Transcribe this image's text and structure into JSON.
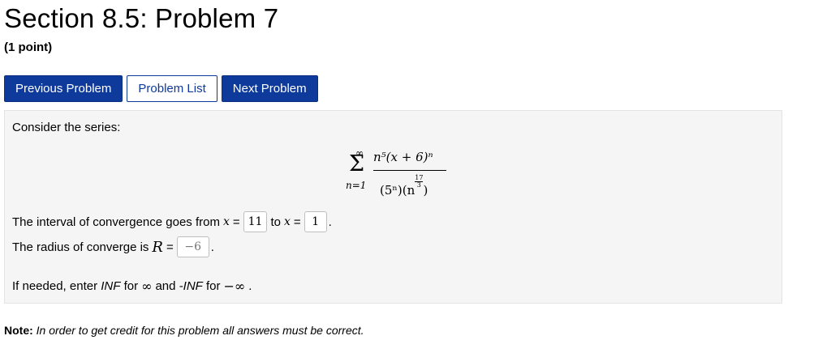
{
  "header": {
    "title": "Section 8.5: Problem 7",
    "points": "(1 point)"
  },
  "nav": {
    "previous": "Previous Problem",
    "list": "Problem List",
    "next": "Next Problem"
  },
  "problem": {
    "intro": "Consider the series:",
    "series": {
      "upper": "∞",
      "sigma": "Σ",
      "lower": "n=1",
      "numerator": "n⁵(x + 6)ⁿ",
      "denominator_left": "(5ⁿ)(n",
      "exp_numer": "17",
      "exp_denom": "3",
      "denominator_right": ")"
    },
    "interval": {
      "prefix": "The interval of convergence goes from",
      "var": "x",
      "eq": "=",
      "from_value": "11",
      "to_label": "to",
      "to_value": "1"
    },
    "radius": {
      "prefix": "The radius of converge is",
      "var": "R",
      "eq": "=",
      "value": "−6"
    },
    "hint": {
      "part1": "If needed, enter",
      "inf": "INF",
      "part2": "for",
      "inf_symbol": "∞",
      "part3": "and",
      "neg_inf": "-INF",
      "part4": "for",
      "neg_inf_symbol": "−∞",
      "period": "."
    }
  },
  "note": {
    "label": "Note:",
    "text": "In order to get credit for this problem all answers must be correct."
  },
  "colors": {
    "primary_button": "#0e3a9c",
    "panel_bg": "#f5f5f5"
  }
}
